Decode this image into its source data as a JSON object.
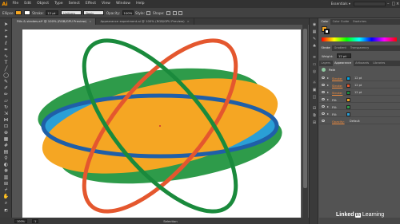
{
  "app": {
    "logo": "Ai"
  },
  "menu": [
    "File",
    "Edit",
    "Object",
    "Type",
    "Select",
    "Effect",
    "View",
    "Window",
    "Help"
  ],
  "workspace": {
    "switcher": "Essentials ▾"
  },
  "control_bar": {
    "selection_label": "Ellipse",
    "stroke_label": "Stroke:",
    "stroke_weight": "12 pt",
    "profile": "Uniform",
    "brush": "Basic",
    "opacity_label": "Opacity:",
    "opacity_value": "100%",
    "style_label": "Style:",
    "shape_label": "Shape:",
    "fill_color": "#f5a623",
    "stroke_color": "#ffffff"
  },
  "tabs": [
    {
      "label": "Fills & strokes.ai* @ 100% (RGB/GPU Preview)",
      "close": "×"
    },
    {
      "label": "Appearance experiment.ai @ 100% (RGB/GPU Preview)",
      "close": "×"
    }
  ],
  "status_bar": {
    "zoom": "100%",
    "artboard": "1",
    "mode": "Selection"
  },
  "panels": {
    "color_tabs": [
      "Color",
      "Color Guide",
      "Swatches"
    ],
    "stroke_tabs": [
      "Stroke",
      "Gradient",
      "Transparency"
    ],
    "weight_label": "Weight:",
    "weight_value": "12 pt",
    "appearance_tabs": [
      "Layers",
      "Appearance",
      "Artboards",
      "Libraries"
    ],
    "object_label": "Path",
    "rows": [
      {
        "label": "Stroke:",
        "value": "12 pt",
        "color": "#00a4e4"
      },
      {
        "label": "Stroke:",
        "value": "12 pt",
        "color": "#e4572e"
      },
      {
        "label": "Stroke:",
        "value": "12 pt",
        "color": "#1a8a3c"
      },
      {
        "label": "Fill:",
        "value": "",
        "color": "#f5a623"
      },
      {
        "label": "Fill:",
        "value": "",
        "color": "#2e9b4a"
      },
      {
        "label": "Fill:",
        "value": "",
        "color": "#2a9fd6"
      }
    ],
    "opacity_label": "Opacity:",
    "opacity_value": "Default"
  },
  "artwork": {
    "colors": {
      "green_fill": "#2e9b4a",
      "cyan_fill": "#2a9fd6",
      "orange_fill": "#f5a623",
      "blue_stroke": "#1f5fa8",
      "orange_stroke": "#e4572e",
      "green_stroke": "#1a8a3c",
      "center_mark": "#cc3333"
    }
  },
  "watermark": {
    "brand": "Linked",
    "box": "in",
    "suffix": "Learning"
  }
}
